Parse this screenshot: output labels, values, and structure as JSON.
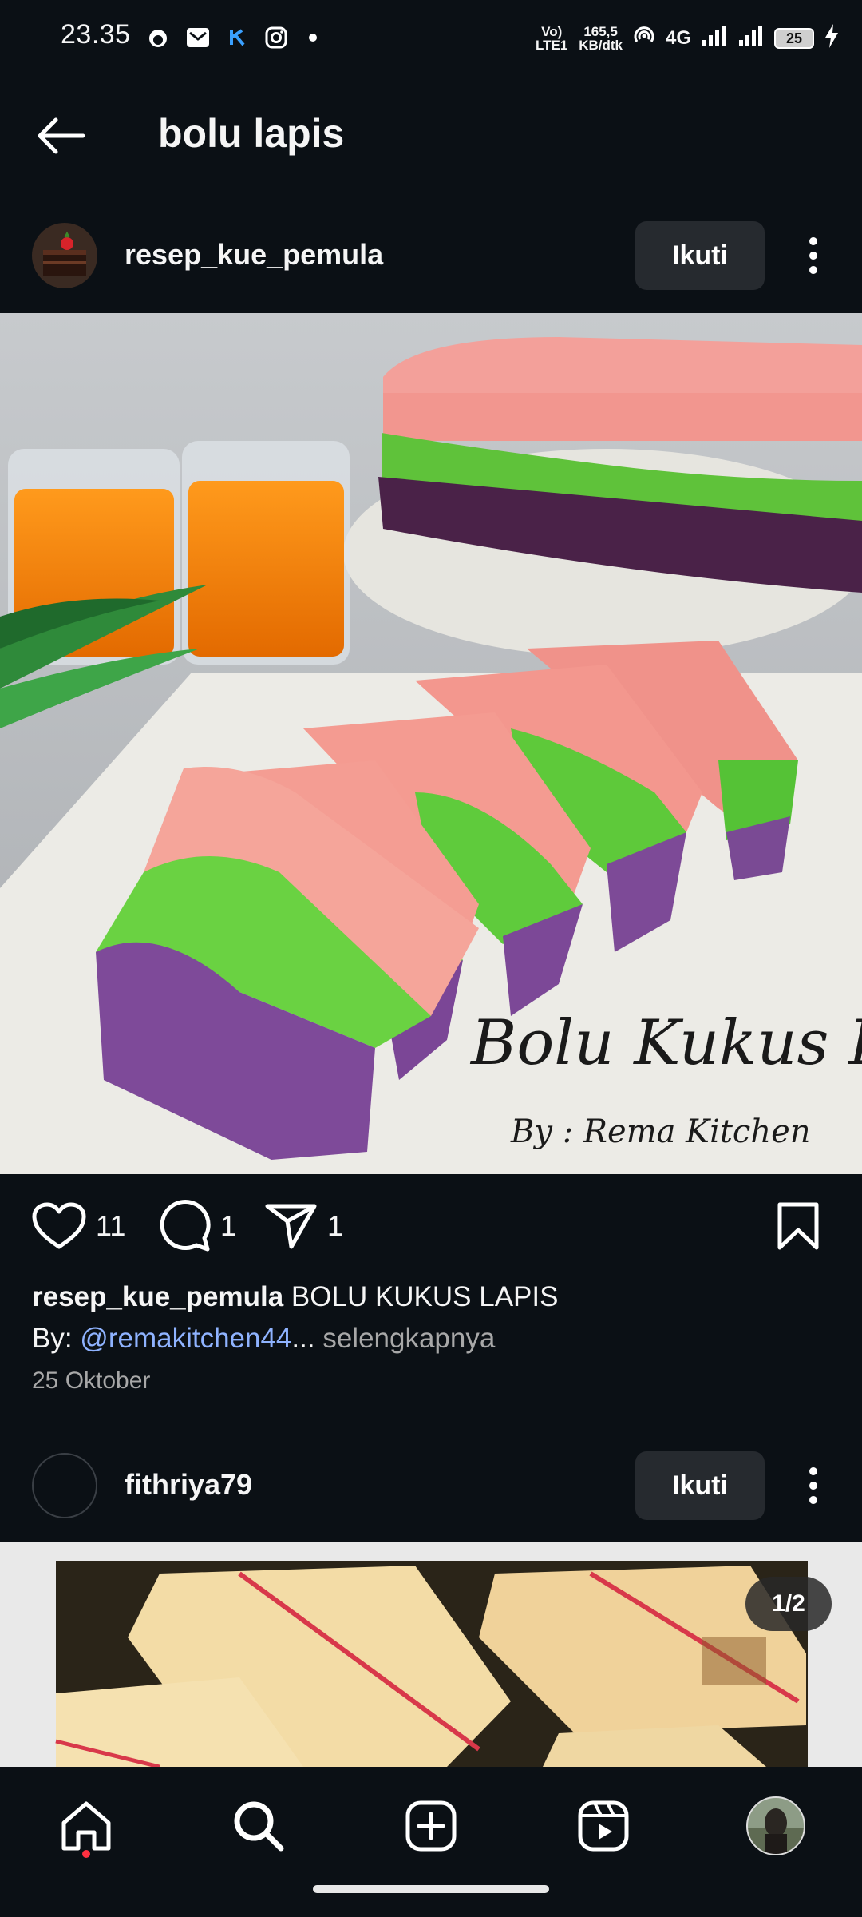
{
  "status_bar": {
    "time": "23.35",
    "volte": "Vo) LTE1",
    "net_speed_value": "165,5",
    "net_speed_unit": "KB/dtk",
    "network": "4G",
    "battery": "25"
  },
  "header": {
    "title": "bolu lapis"
  },
  "post1": {
    "username": "resep_kue_pemula",
    "follow_label": "Ikuti",
    "image_text_line1": "Bolu Kukus Lapis",
    "image_text_line2": "By : Rema Kitchen",
    "likes": "11",
    "comments": "1",
    "shares": "1",
    "caption_user": "resep_kue_pemula",
    "caption_text": "BOLU KUKUS LAPIS",
    "caption_line2_prefix": "By: ",
    "caption_mention": "@remakitchen44",
    "caption_ellipsis": "...",
    "caption_more": "selengkapnya",
    "date": "25 Oktober"
  },
  "post2": {
    "username": "fithriya79",
    "follow_label": "Ikuti",
    "page_indicator": "1/2"
  },
  "colors": {
    "background": "#0b1015",
    "button": "#262a2f",
    "mention": "#8fb3ff",
    "notification_dot": "#ff3040"
  },
  "icons": [
    "back-arrow-icon",
    "heart-icon",
    "comment-icon",
    "share-icon",
    "bookmark-icon",
    "more-icon",
    "home-icon",
    "search-icon",
    "create-icon",
    "reels-icon"
  ]
}
